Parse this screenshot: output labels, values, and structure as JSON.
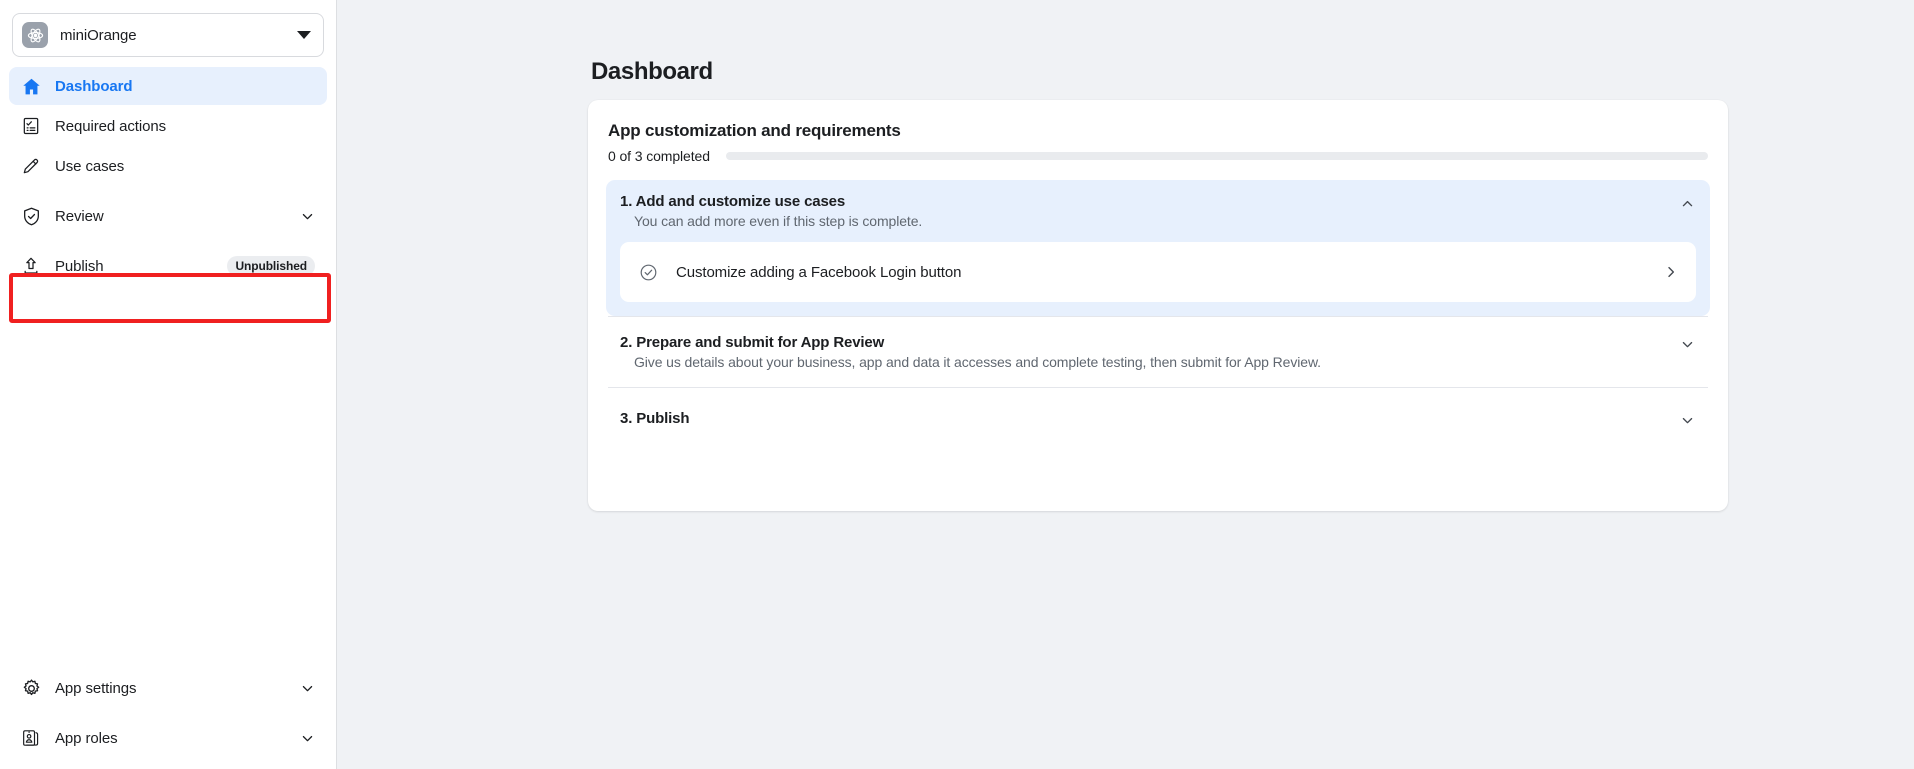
{
  "sidebar": {
    "app_switcher": {
      "app_name": "miniOrange",
      "avatar_icon": "atom-icon",
      "caret_icon": "caret-down-icon"
    },
    "items": [
      {
        "label": "Dashboard",
        "icon": "home-icon",
        "active": true,
        "badge": null,
        "chevron": false
      },
      {
        "label": "Required actions",
        "icon": "checklist-icon",
        "active": false,
        "badge": null,
        "chevron": false
      },
      {
        "label": "Use cases",
        "icon": "pencil-icon",
        "active": false,
        "badge": null,
        "chevron": false
      },
      {
        "label": "Review",
        "icon": "shield-check-icon",
        "active": false,
        "badge": null,
        "chevron": true
      },
      {
        "label": "Publish",
        "icon": "upload-icon",
        "active": false,
        "badge": "Unpublished",
        "chevron": false
      }
    ],
    "bottom_items": [
      {
        "label": "App settings",
        "icon": "gear-icon",
        "chevron": true
      },
      {
        "label": "App roles",
        "icon": "id-badge-icon",
        "chevron": true
      }
    ],
    "highlight_color": "#f02020"
  },
  "main": {
    "page_title": "Dashboard",
    "card": {
      "title": "App customization and requirements",
      "progress": {
        "label": "0 of 3 completed",
        "completed": 0,
        "total": 3,
        "percent": 0
      },
      "steps": [
        {
          "number": "1.",
          "title": "Add and customize use cases",
          "title_full": "1. Add and customize use cases",
          "description": "You can add more even if this step is complete.",
          "expanded": true,
          "toggle_icon": "chevron-up-icon",
          "subtasks": [
            {
              "label": "Customize adding a Facebook Login button",
              "status_icon": "check-circle-icon",
              "arrow_icon": "chevron-right-icon"
            }
          ]
        },
        {
          "number": "2.",
          "title": "Prepare and submit for App Review",
          "title_full": "2. Prepare and submit for App Review",
          "description": "Give us details about your business, app and data it accesses and complete testing, then submit for App Review.",
          "expanded": false,
          "toggle_icon": "chevron-down-icon",
          "subtasks": []
        },
        {
          "number": "3.",
          "title": "Publish",
          "title_full": "3. Publish",
          "description": "",
          "expanded": false,
          "toggle_icon": "chevron-down-icon",
          "subtasks": []
        }
      ]
    }
  },
  "colors": {
    "accent": "#1877f2",
    "background": "#f0f2f5",
    "card": "#ffffff",
    "highlight_blue": "#e7f0fd",
    "text": "#1c1e21",
    "muted_text": "#606770",
    "annotation_red": "#f02020"
  }
}
